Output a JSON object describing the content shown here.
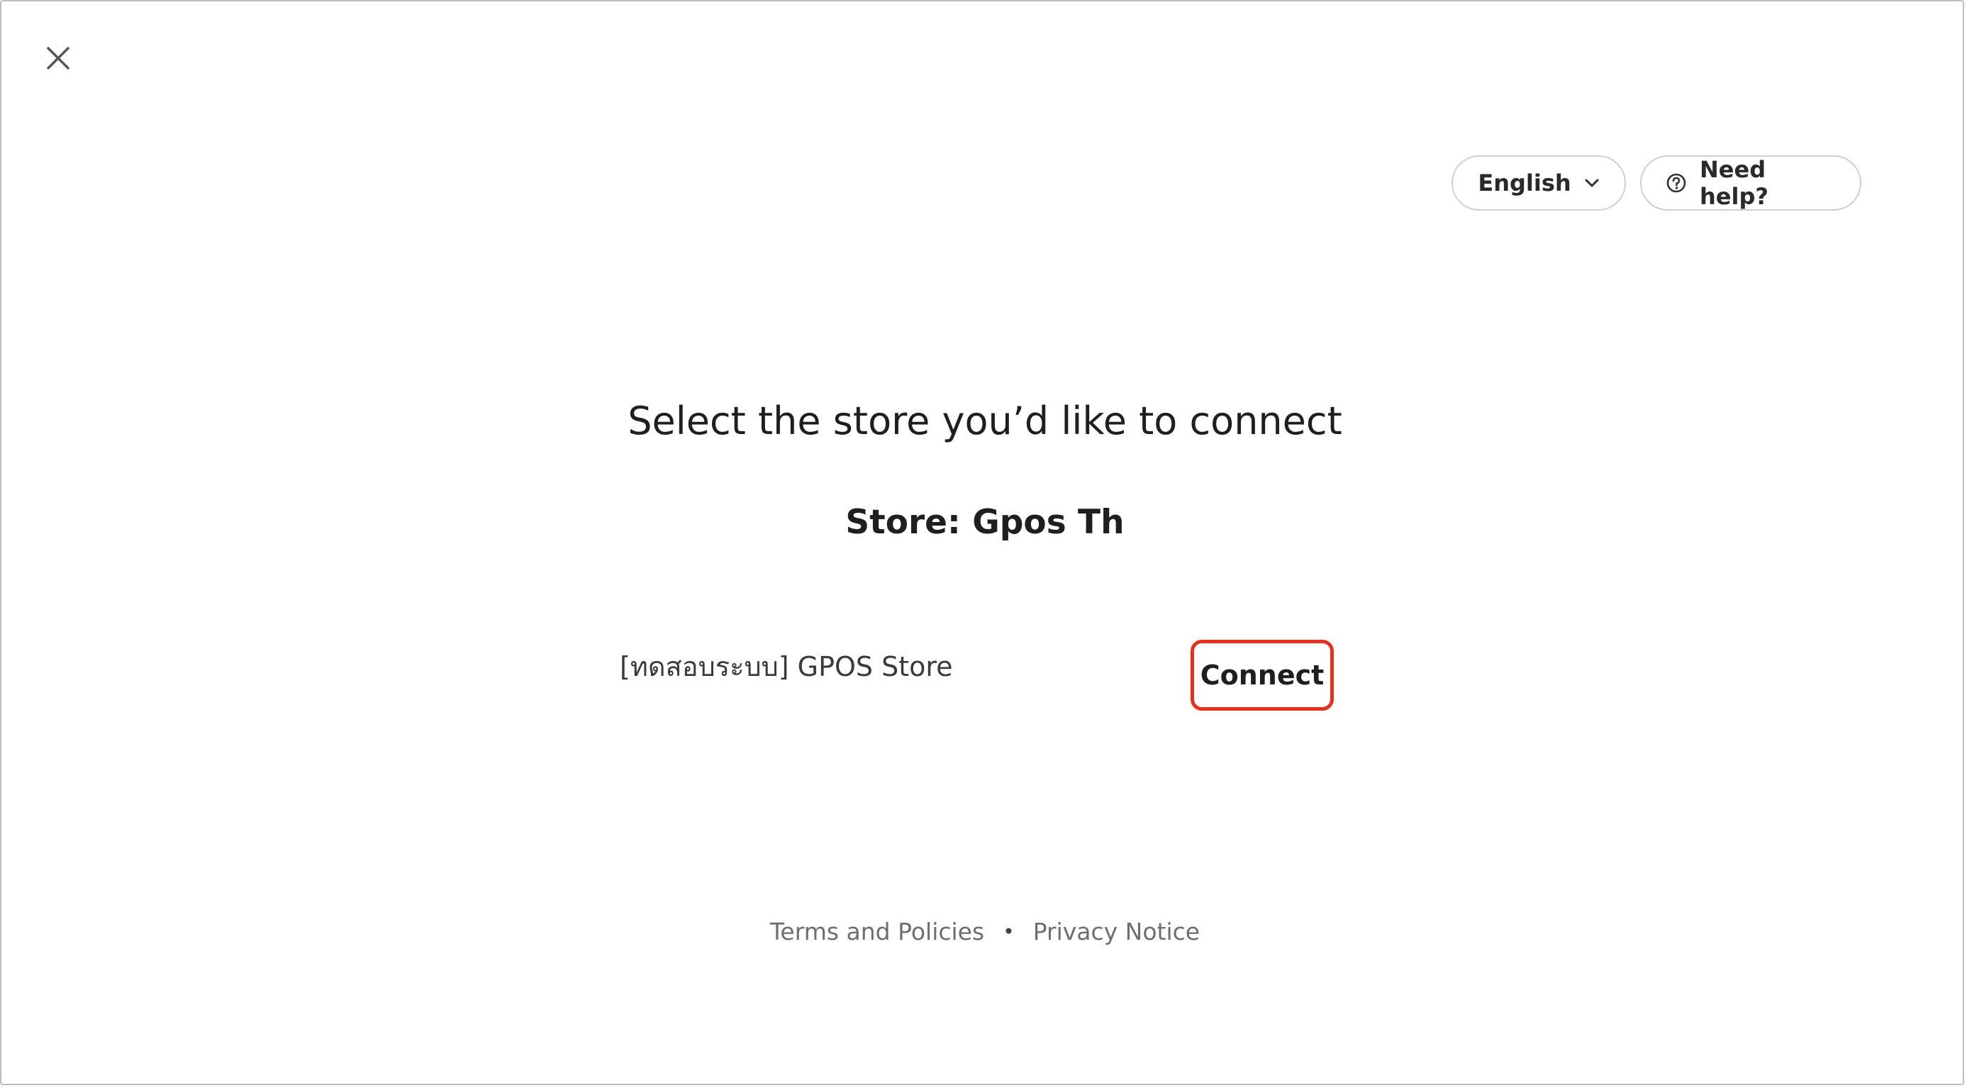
{
  "header": {
    "close_icon": "close-icon",
    "language_label": "English",
    "language_icon": "chevron-down-icon",
    "help_label": "Need help?",
    "help_icon": "question-circle-icon"
  },
  "main": {
    "title": "Select the store you’d like to connect",
    "store_heading": "Store: Gpos Th",
    "stores": [
      {
        "name": "[ทดสอบระบบ] GPOS Store",
        "action_label": "Connect"
      }
    ]
  },
  "footer": {
    "terms_label": "Terms and Policies",
    "separator": "•",
    "privacy_label": "Privacy Notice"
  },
  "colors": {
    "highlight": "#e8311d",
    "text": "#1f1f1f",
    "muted": "#6e6e6e"
  }
}
